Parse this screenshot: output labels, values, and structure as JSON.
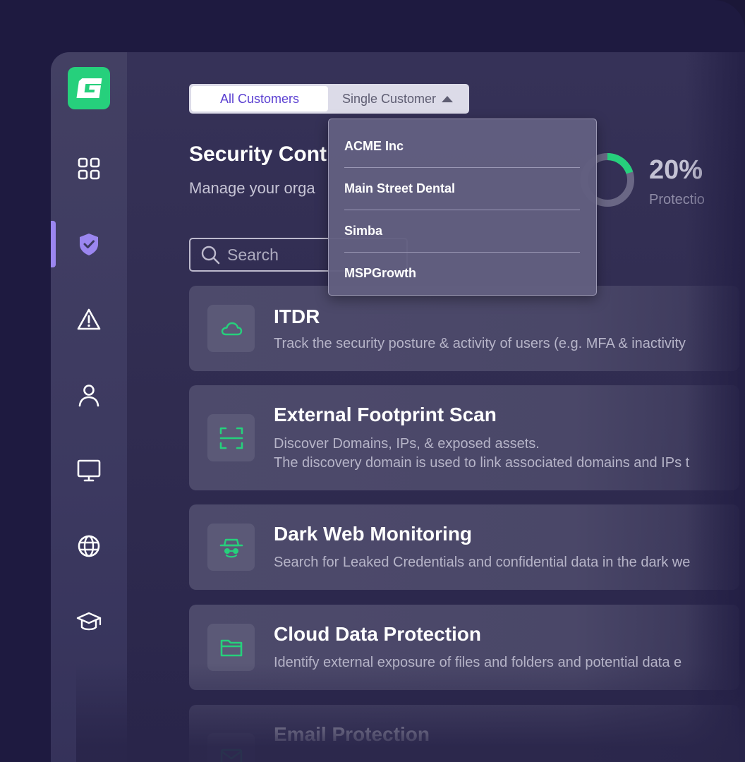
{
  "segmented": {
    "all_label": "All Customers",
    "single_label": "Single Customer"
  },
  "header": {
    "title": "Security Cont",
    "subtitle": "Manage your orga"
  },
  "protection": {
    "percent_label": "20%",
    "percent_value": 20,
    "label": "Protectio"
  },
  "search": {
    "placeholder": "Search"
  },
  "dropdown": {
    "items": [
      "ACME Inc",
      "Main Street Dental",
      "Simba",
      "MSPGrowth"
    ]
  },
  "cards": [
    {
      "title": "ITDR",
      "desc": [
        "Track the security posture & activity of users (e.g. MFA & inactivity"
      ],
      "icon": "cloud-icon"
    },
    {
      "title": "External Footprint Scan",
      "desc": [
        "Discover Domains, IPs, & exposed assets.",
        "The discovery domain is used to link associated domains and IPs t"
      ],
      "icon": "scan-icon"
    },
    {
      "title": "Dark Web Monitoring",
      "desc": [
        "Search for Leaked Credentials and confidential data in the dark we"
      ],
      "icon": "spy-icon"
    },
    {
      "title": "Cloud Data Protection",
      "desc": [
        "Identify external exposure of files and folders and potential data e"
      ],
      "icon": "folder-icon"
    },
    {
      "title": "Email Protection",
      "desc": [],
      "icon": "mail-icon"
    }
  ],
  "colors": {
    "brand_green": "#26d07c",
    "accent_purple": "#9b86f0",
    "active_tab_text": "#5a3fd1"
  },
  "sidebar": {
    "icons": [
      "dashboard-icon",
      "shield-check-icon",
      "warning-icon",
      "user-icon",
      "monitor-icon",
      "globe-icon",
      "graduation-cap-icon"
    ]
  }
}
